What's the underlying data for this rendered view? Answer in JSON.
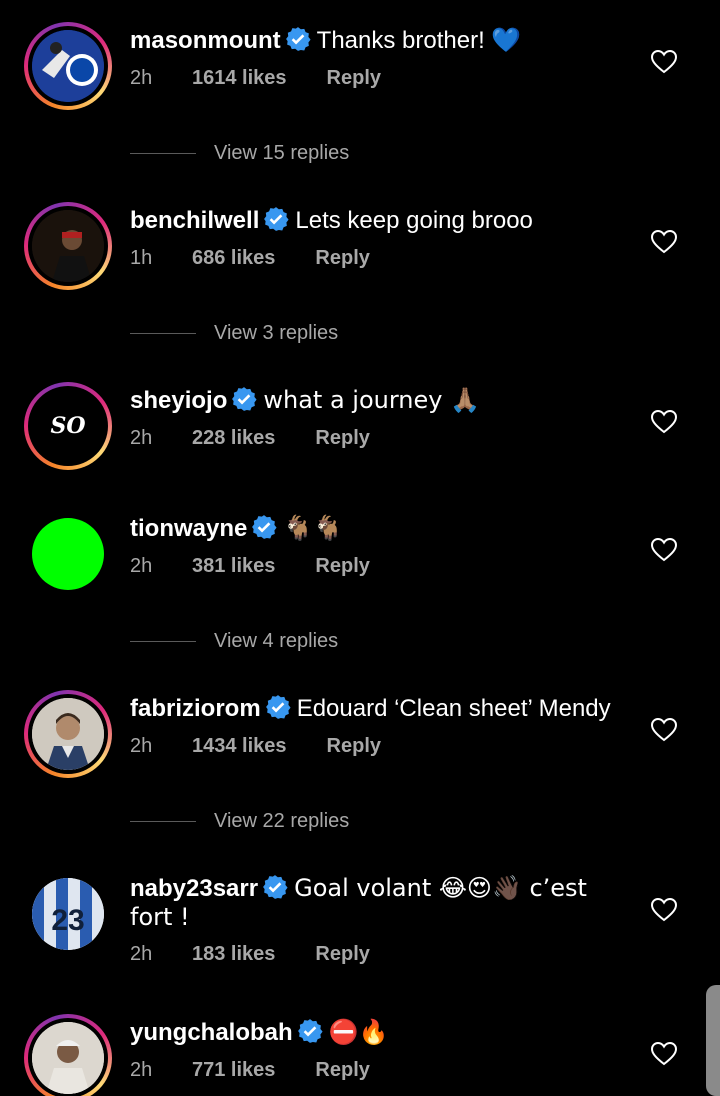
{
  "comments": [
    {
      "user": "masonmount",
      "text": "Thanks brother! 💙",
      "time": "2h",
      "likes": "1614 likes",
      "reply": "Reply",
      "view_replies": "View 15 replies"
    },
    {
      "user": "benchilwell",
      "text": "Lets keep going brooo",
      "time": "1h",
      "likes": "686 likes",
      "reply": "Reply",
      "view_replies": "View 3 replies"
    },
    {
      "user": "sheyiojo",
      "text": "what a journey 🙏🏽",
      "time": "2h",
      "likes": "228 likes",
      "reply": "Reply",
      "avatar_text": "SO"
    },
    {
      "user": "tionwayne",
      "text": "🐐🐐",
      "time": "2h",
      "likes": "381 likes",
      "reply": "Reply",
      "view_replies": "View 4 replies"
    },
    {
      "user": "fabriziorom",
      "text": "Edouard ‘Clean sheet’ Mendy",
      "time": "2h",
      "likes": "1434 likes",
      "reply": "Reply",
      "view_replies": "View 22 replies"
    },
    {
      "user": "naby23sarr",
      "text": "Goal volant 😂😍👋🏿 c’est fort !",
      "time": "2h",
      "likes": "183 likes",
      "reply": "Reply"
    },
    {
      "user": "yungchalobah",
      "text": "⛔🔥",
      "time": "2h",
      "likes": "771 likes",
      "reply": "Reply"
    }
  ],
  "colors": {
    "verified": "#3897f0",
    "meta": "#a8a8a8",
    "green_avatar": "#00ff00"
  }
}
